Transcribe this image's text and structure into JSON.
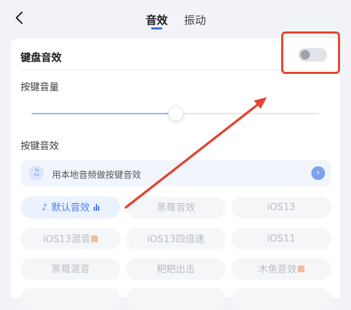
{
  "header": {
    "tabs": [
      {
        "label": "音效",
        "active": true
      },
      {
        "label": "振动",
        "active": false
      }
    ],
    "back_icon": "chevron-left-icon",
    "accent_color": "#2d6cf0"
  },
  "keyboard_sound": {
    "title": "键盘音效",
    "enabled": false
  },
  "volume": {
    "title": "按键音量",
    "level_fraction": 0.503
  },
  "key_sound": {
    "title": "按键音效",
    "local_audio_label": "用本地音频做按键音效",
    "music_icon": "music-note-icon",
    "chevron_icon": "chevron-right-icon",
    "chips": [
      {
        "label": "默认音效",
        "selected": true
      },
      {
        "label": "黑莓音效",
        "selected": false
      },
      {
        "label": "iOS13",
        "selected": false
      },
      {
        "label": "iOS13混音",
        "selected": false
      },
      {
        "label": "iOS13四倍速",
        "selected": false
      },
      {
        "label": "iOS11",
        "selected": false
      },
      {
        "label": "黑莓混音",
        "selected": false
      },
      {
        "label": "粑粑出击",
        "selected": false
      },
      {
        "label": "木鱼音效",
        "selected": false
      }
    ]
  },
  "annotation_color": "#e3432f"
}
